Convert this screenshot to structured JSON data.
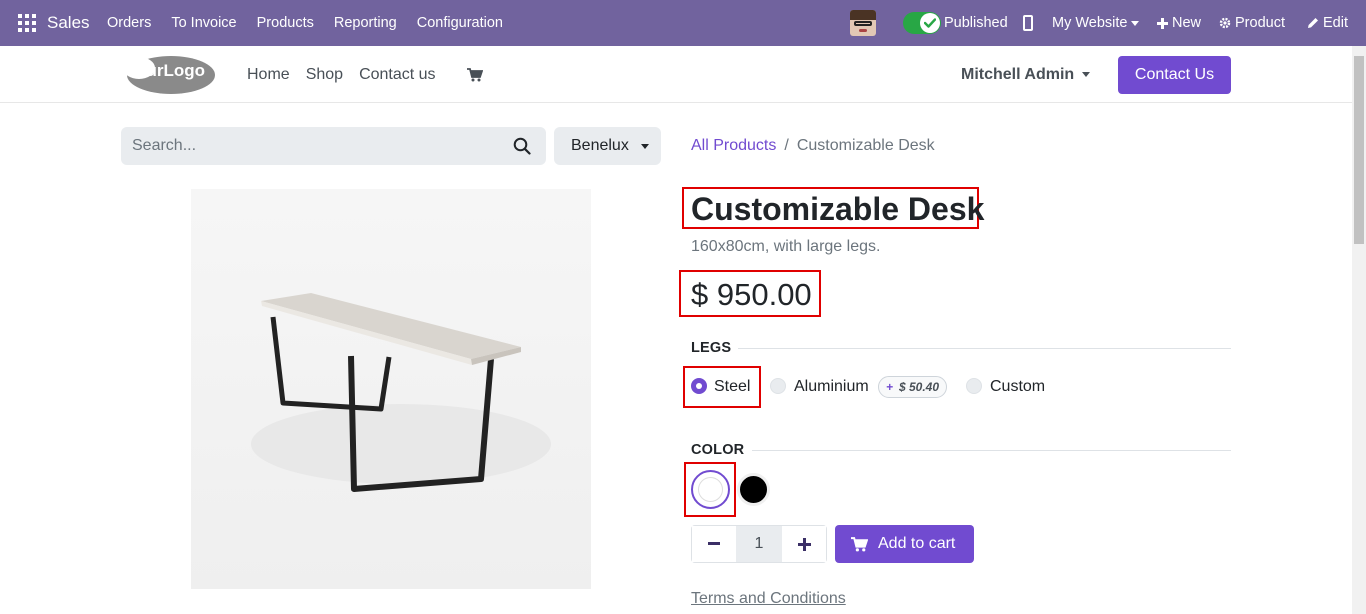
{
  "adminbar": {
    "app_name": "Sales",
    "menu": [
      "Orders",
      "To Invoice",
      "Products",
      "Reporting",
      "Configuration"
    ],
    "published_label": "Published",
    "website_label": "My Website",
    "new_label": "New",
    "product_label": "Product",
    "edit_label": "Edit",
    "color": "#71639e"
  },
  "header": {
    "logo_text": "YourLogo",
    "nav": [
      "Home",
      "Shop",
      "Contact us"
    ],
    "user": "Mitchell Admin",
    "contact_button": "Contact Us"
  },
  "search": {
    "placeholder": "Search...",
    "pricelist": "Benelux"
  },
  "breadcrumb": {
    "parent": "All Products",
    "separator": "/",
    "current": "Customizable Desk"
  },
  "product": {
    "name": "Customizable Desk",
    "description": "160x80cm, with large legs.",
    "price": "$ 950.00",
    "attributes": {
      "legs": {
        "label": "LEGS",
        "options": [
          {
            "label": "Steel",
            "selected": true
          },
          {
            "label": "Aluminium",
            "selected": false,
            "extra": "$ 50.40"
          },
          {
            "label": "Custom",
            "selected": false
          }
        ]
      },
      "color": {
        "label": "COLOR",
        "options": [
          {
            "name": "White",
            "hex": "#ffffff",
            "selected": true
          },
          {
            "name": "Black",
            "hex": "#000000",
            "selected": false
          }
        ]
      }
    },
    "quantity": "1",
    "add_to_cart": "Add to cart",
    "terms": "Terms and Conditions"
  },
  "colors": {
    "primary": "#714bd0",
    "highlight_box": "#e00000"
  }
}
